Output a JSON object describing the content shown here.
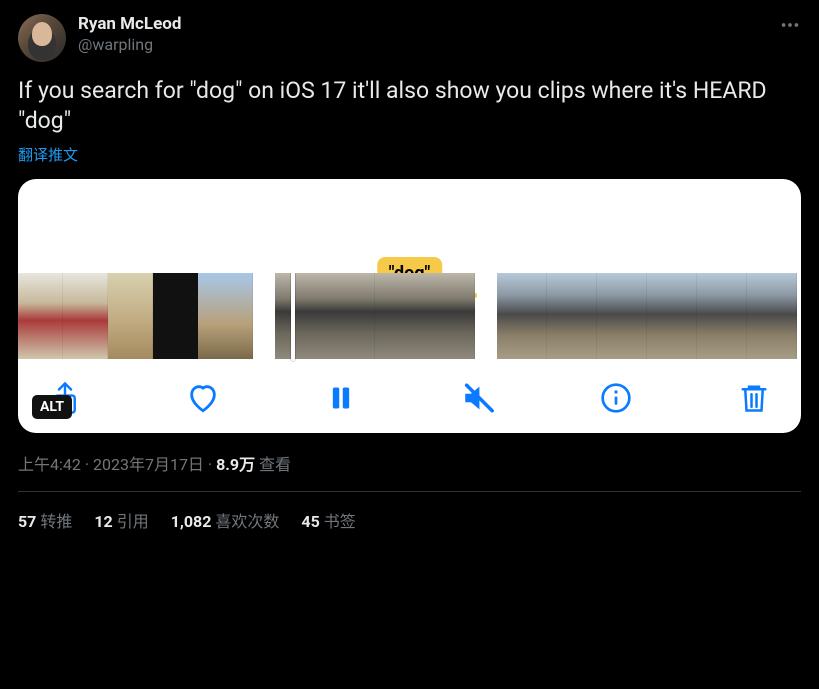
{
  "author": {
    "display_name": "Ryan McLeod",
    "handle": "@warpling"
  },
  "tweet_text": "If you search for \"dog\" on iOS 17 it'll also show you clips where it's HEARD \"dog\"",
  "translate_label": "翻译推文",
  "media": {
    "badge_text": "\"dog\"",
    "alt_label": "ALT",
    "controls": [
      "share",
      "heart",
      "pause",
      "mute",
      "info",
      "trash"
    ]
  },
  "meta": {
    "time": "上午4:42",
    "date": "2023年7月17日",
    "views_number": "8.9万",
    "views_label": "查看"
  },
  "stats": {
    "retweets": {
      "count": "57",
      "label": "转推"
    },
    "quotes": {
      "count": "12",
      "label": "引用"
    },
    "likes": {
      "count": "1,082",
      "label": "喜欢次数"
    },
    "bookmarks": {
      "count": "45",
      "label": "书签"
    }
  }
}
